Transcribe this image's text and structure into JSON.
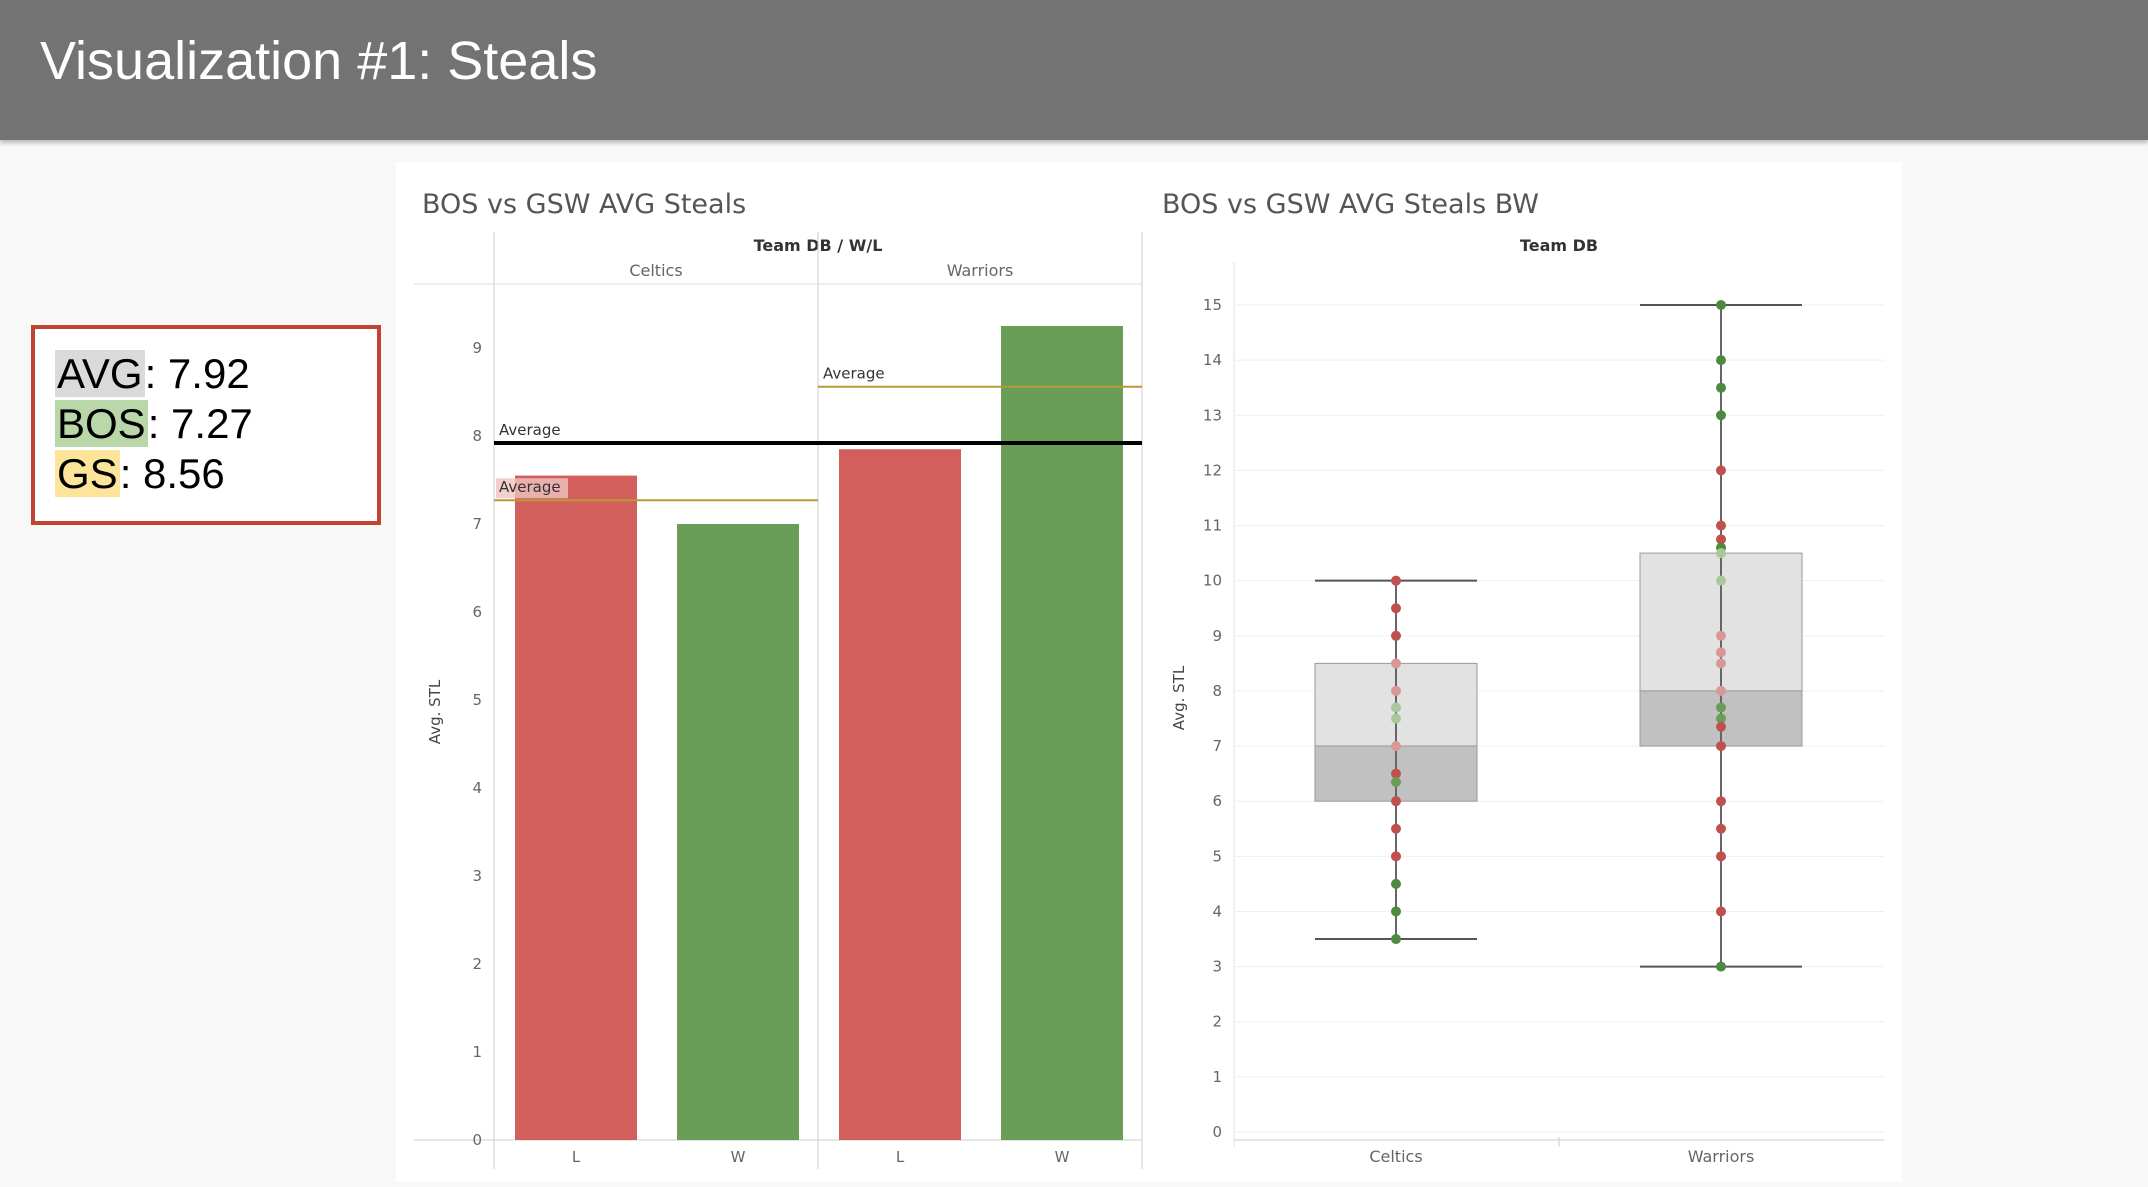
{
  "header": {
    "title": "Visualization #1: Steals"
  },
  "stats": {
    "rows": [
      {
        "label": "AVG",
        "value": ": 7.92",
        "color": "#dadada"
      },
      {
        "label": "BOS",
        "value": ": 7.27",
        "color": "#b9d7a8"
      },
      {
        "label": "GS",
        "value": ": 8.56",
        "color": "#fde49b"
      }
    ]
  },
  "chart_data": [
    {
      "type": "bar",
      "title": "BOS vs GSW AVG Steals",
      "header_label": "Team DB / W/L",
      "groups": [
        "Celtics",
        "Warriors"
      ],
      "ylabel": "Avg. STL",
      "ylim": [
        0,
        9.3
      ],
      "yticks": [
        0,
        1,
        2,
        3,
        4,
        5,
        6,
        7,
        8,
        9
      ],
      "bars": [
        {
          "group": "Celtics",
          "category": "L",
          "value": 7.55,
          "color": "#d35f5c"
        },
        {
          "group": "Celtics",
          "category": "W",
          "value": 7.0,
          "color": "#6a9d56"
        },
        {
          "group": "Warriors",
          "category": "L",
          "value": 7.85,
          "color": "#d35f5c"
        },
        {
          "group": "Warriors",
          "category": "W",
          "value": 9.25,
          "color": "#6a9d56"
        }
      ],
      "reference_lines": [
        {
          "label": "Average",
          "scope": "all",
          "value": 7.92,
          "color": "#000000"
        },
        {
          "label": "Average",
          "scope": "Celtics",
          "value": 7.27,
          "color": "#b59a34"
        },
        {
          "label": "Average",
          "scope": "Warriors",
          "value": 8.56,
          "color": "#b59a34"
        }
      ]
    },
    {
      "type": "box",
      "title": "BOS vs GSW AVG Steals BW",
      "header_label": "Team DB",
      "categories": [
        "Celtics",
        "Warriors"
      ],
      "ylabel": "Avg. STL",
      "ylim": [
        0,
        15.5
      ],
      "yticks": [
        0,
        1,
        2,
        3,
        4,
        5,
        6,
        7,
        8,
        9,
        10,
        11,
        12,
        13,
        14,
        15
      ],
      "boxes": [
        {
          "category": "Celtics",
          "min": 3.5,
          "q1": 6,
          "median": 7,
          "q3": 8.5,
          "max": 10,
          "points": [
            {
              "y": 10,
              "c": "#c0504d"
            },
            {
              "y": 9.5,
              "c": "#c0504d"
            },
            {
              "y": 9,
              "c": "#c0504d"
            },
            {
              "y": 8.5,
              "c": "#d89996"
            },
            {
              "y": 8,
              "c": "#d89996"
            },
            {
              "y": 7.7,
              "c": "#a8c89a"
            },
            {
              "y": 7.5,
              "c": "#a8c89a"
            },
            {
              "y": 7,
              "c": "#d89996"
            },
            {
              "y": 6.5,
              "c": "#c0504d"
            },
            {
              "y": 6.35,
              "c": "#6a9d56"
            },
            {
              "y": 6,
              "c": "#c0504d"
            },
            {
              "y": 5.5,
              "c": "#c0504d"
            },
            {
              "y": 5,
              "c": "#c0504d"
            },
            {
              "y": 4.5,
              "c": "#4e8a3e"
            },
            {
              "y": 4,
              "c": "#4e8a3e"
            },
            {
              "y": 3.5,
              "c": "#4e8a3e"
            }
          ]
        },
        {
          "category": "Warriors",
          "min": 3,
          "q1": 7,
          "median": 8,
          "q3": 10.5,
          "max": 15,
          "points": [
            {
              "y": 15,
              "c": "#4e8a3e"
            },
            {
              "y": 14,
              "c": "#4e8a3e"
            },
            {
              "y": 13.5,
              "c": "#4e8a3e"
            },
            {
              "y": 13,
              "c": "#4e8a3e"
            },
            {
              "y": 12,
              "c": "#c0504d"
            },
            {
              "y": 11,
              "c": "#c0504d"
            },
            {
              "y": 10.75,
              "c": "#c0504d"
            },
            {
              "y": 10.6,
              "c": "#4e8a3e"
            },
            {
              "y": 10.5,
              "c": "#a8c89a"
            },
            {
              "y": 10,
              "c": "#a8c89a"
            },
            {
              "y": 9,
              "c": "#d89996"
            },
            {
              "y": 8.7,
              "c": "#d89996"
            },
            {
              "y": 8.5,
              "c": "#d89996"
            },
            {
              "y": 8,
              "c": "#d89996"
            },
            {
              "y": 7.7,
              "c": "#6a9d56"
            },
            {
              "y": 7.5,
              "c": "#6a9d56"
            },
            {
              "y": 7.35,
              "c": "#c0504d"
            },
            {
              "y": 7,
              "c": "#c0504d"
            },
            {
              "y": 6,
              "c": "#c0504d"
            },
            {
              "y": 5.5,
              "c": "#c0504d"
            },
            {
              "y": 5,
              "c": "#c0504d"
            },
            {
              "y": 4,
              "c": "#c0504d"
            },
            {
              "y": 3,
              "c": "#4e8a3e"
            }
          ]
        }
      ]
    }
  ]
}
